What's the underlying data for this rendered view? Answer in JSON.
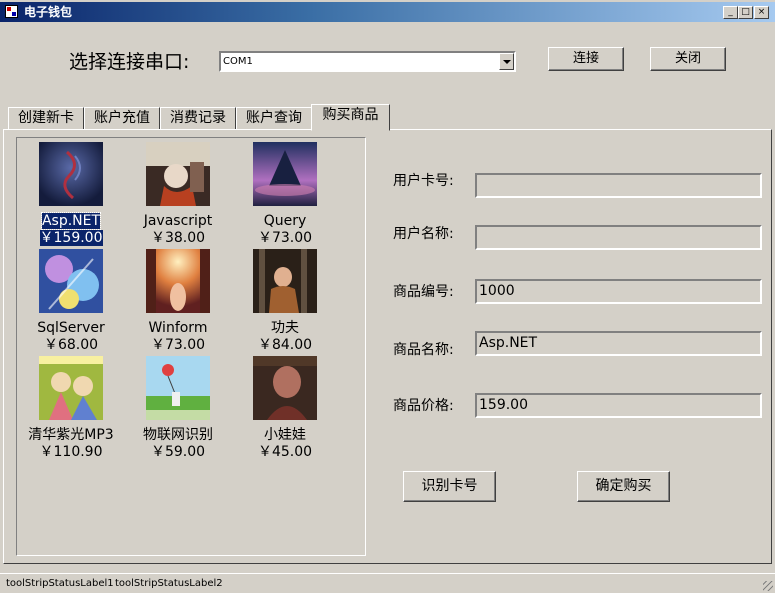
{
  "window": {
    "title": "电子钱包",
    "controls": [
      "_",
      "□",
      "×"
    ]
  },
  "serial": {
    "label": "选择连接串口:",
    "port_value": "COM1",
    "connect_label": "连接",
    "close_label": "关闭"
  },
  "tabs": [
    {
      "label": "创建新卡"
    },
    {
      "label": "账户充值"
    },
    {
      "label": "消费记录"
    },
    {
      "label": "账户查询"
    },
    {
      "label": "购买商品",
      "active": true
    }
  ],
  "products": [
    {
      "name": "Asp.NET",
      "price": "￥159.00",
      "selected": true
    },
    {
      "name": "Javascript",
      "price": "￥38.00"
    },
    {
      "name": "Query",
      "price": "￥73.00"
    },
    {
      "name": "SqlServer",
      "price": "￥68.00"
    },
    {
      "name": "Winform",
      "price": "￥73.00"
    },
    {
      "name": "功夫",
      "price": "￥84.00"
    },
    {
      "name": "清华紫光MP3",
      "price": "￥110.90"
    },
    {
      "name": "物联网识别",
      "price": "￥59.00"
    },
    {
      "name": "小娃娃",
      "price": "￥45.00"
    }
  ],
  "form": {
    "card_no_label": "用户卡号:",
    "card_no_value": "",
    "user_name_label": "用户名称:",
    "user_name_value": "",
    "product_id_label": "商品编号:",
    "product_id_value": "1000",
    "product_name_label": "商品名称:",
    "product_name_value": "Asp.NET",
    "product_price_label": "商品价格:",
    "product_price_value": "159.00",
    "identify_label": "识别卡号",
    "buy_label": "确定购买"
  },
  "status": {
    "label1": "toolStripStatusLabel1",
    "label2": "toolStripStatusLabel2"
  }
}
